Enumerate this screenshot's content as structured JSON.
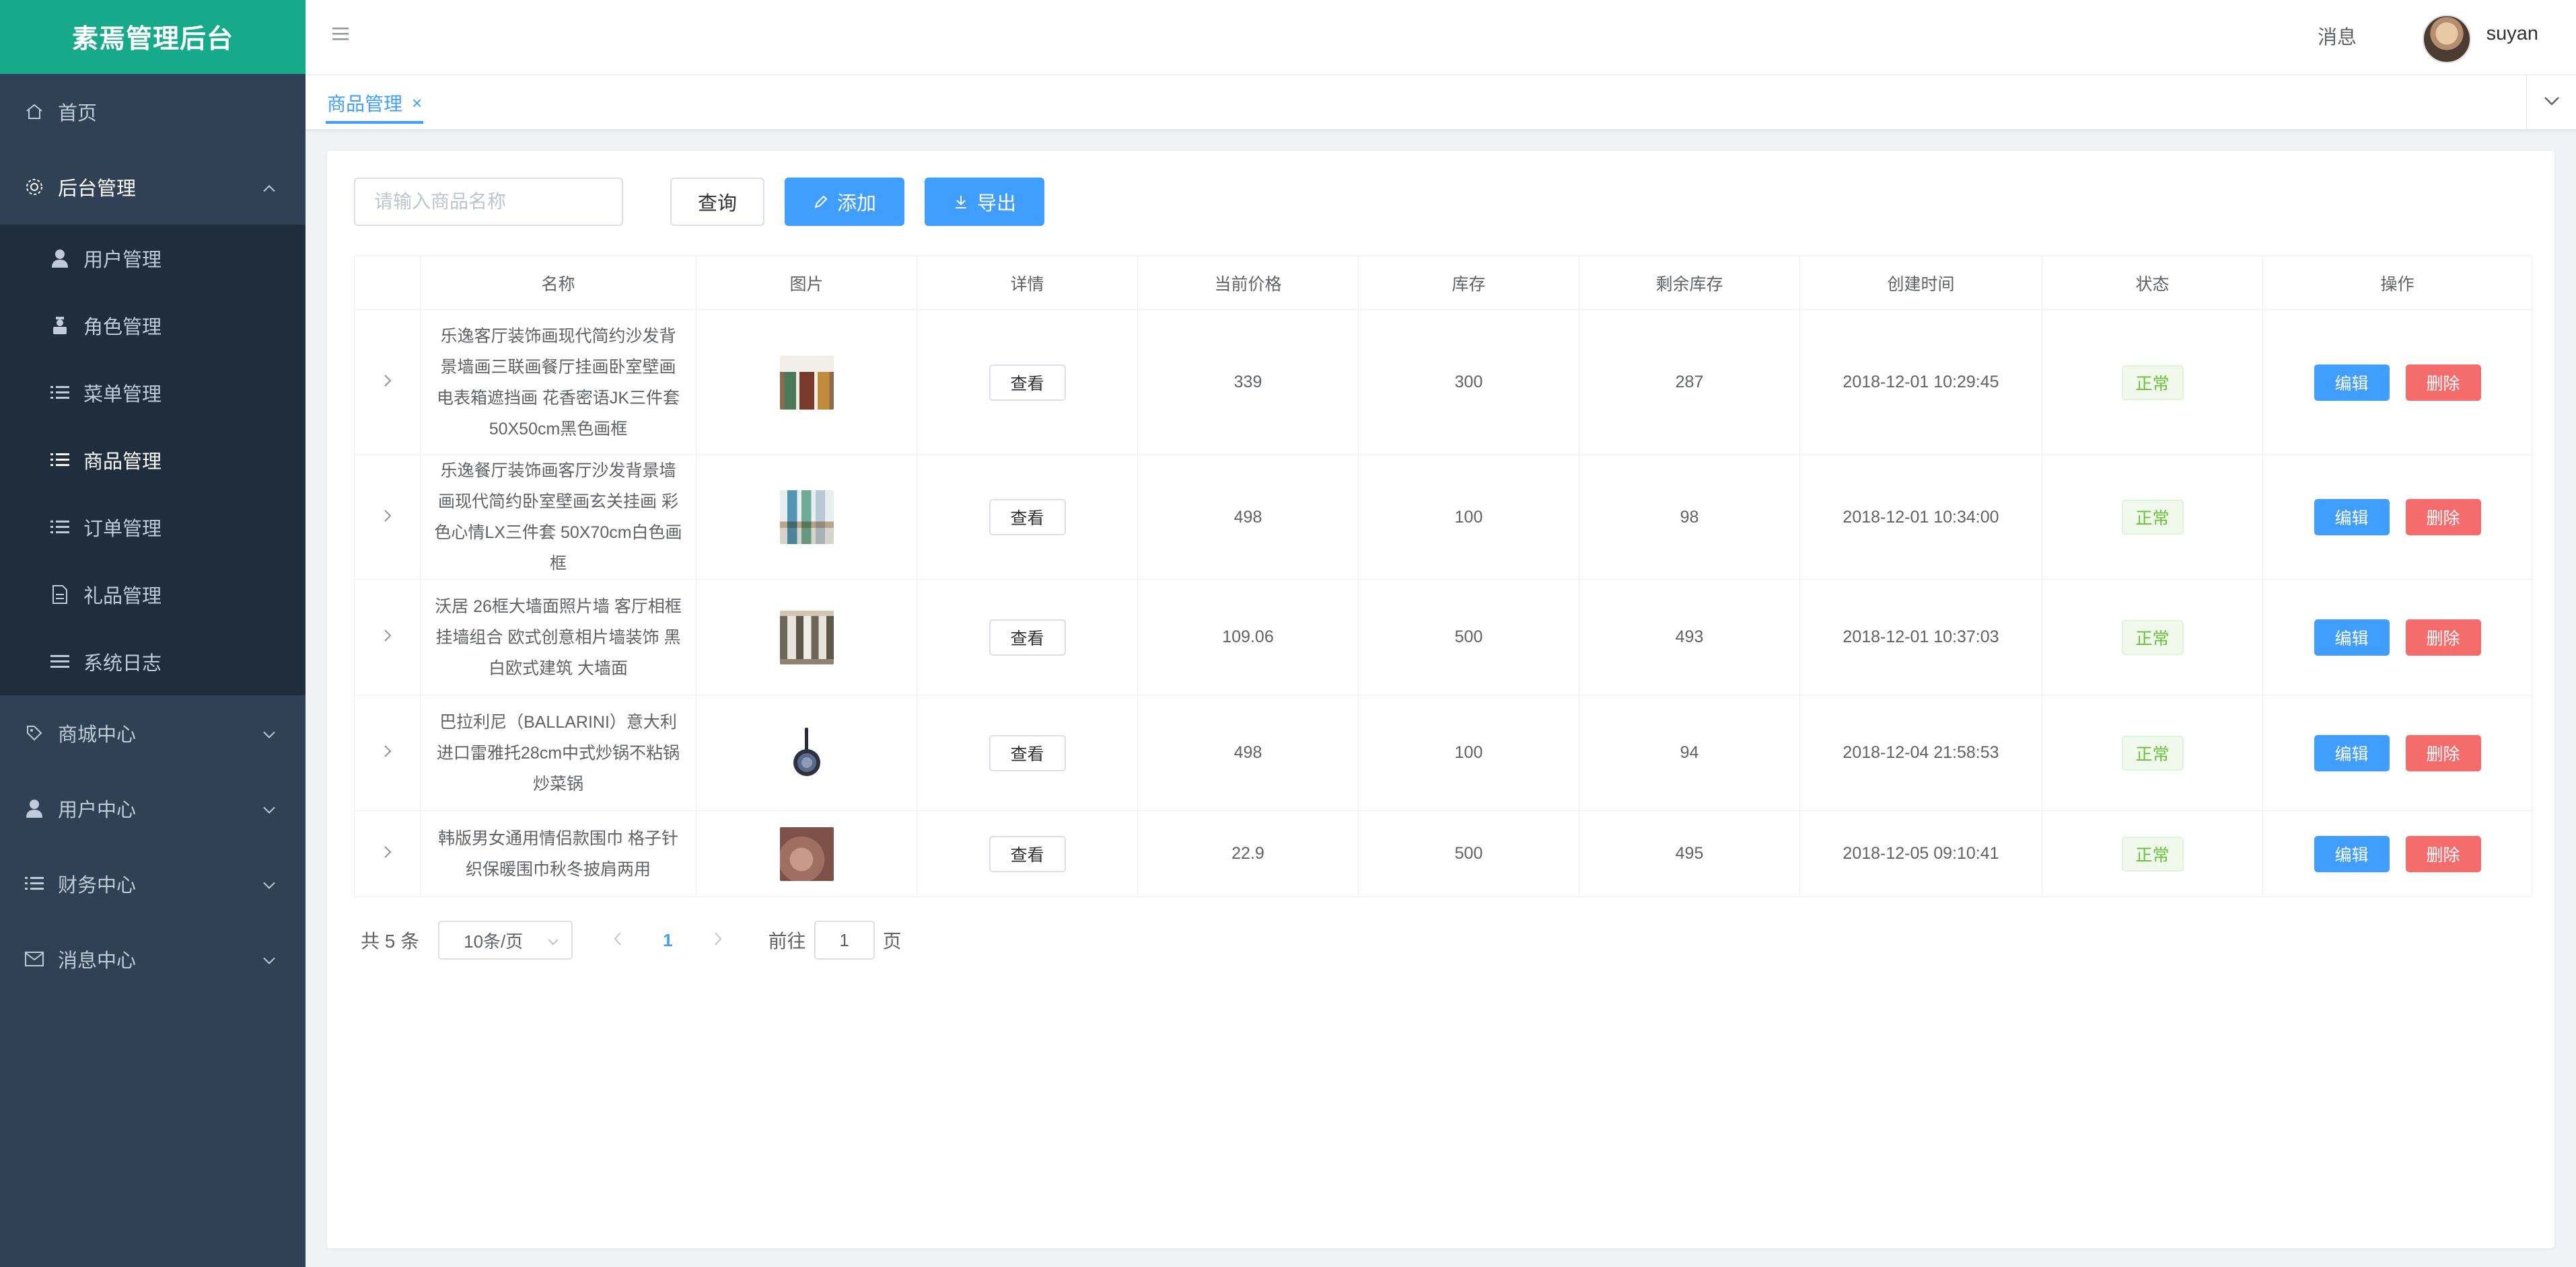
{
  "sidebar": {
    "logo": "素焉管理后台",
    "items": [
      {
        "label": "首页",
        "icon": "home-icon"
      },
      {
        "label": "后台管理",
        "icon": "gear-icon",
        "open": true
      },
      {
        "label": "商城中心",
        "icon": "tag-icon"
      },
      {
        "label": "用户中心",
        "icon": "user-icon"
      },
      {
        "label": "财务中心",
        "icon": "list-icon"
      },
      {
        "label": "消息中心",
        "icon": "mail-icon"
      }
    ],
    "sub_items": [
      {
        "label": "用户管理",
        "icon": "user-icon"
      },
      {
        "label": "角色管理",
        "icon": "role-icon"
      },
      {
        "label": "菜单管理",
        "icon": "list-icon"
      },
      {
        "label": "商品管理",
        "icon": "list-icon",
        "active": true
      },
      {
        "label": "订单管理",
        "icon": "list-icon"
      },
      {
        "label": "礼品管理",
        "icon": "document-icon"
      },
      {
        "label": "系统日志",
        "icon": "menu-icon"
      }
    ]
  },
  "header": {
    "messages": "消息",
    "username": "suyan"
  },
  "tags": [
    {
      "label": "商品管理",
      "close": "×"
    }
  ],
  "toolbar": {
    "search_placeholder": "请输入商品名称",
    "search_value": "",
    "query_label": "查询",
    "add_label": "添加",
    "export_label": "导出"
  },
  "table": {
    "columns": [
      "名称",
      "图片",
      "详情",
      "当前价格",
      "库存",
      "剩余库存",
      "创建时间",
      "状态",
      "操作"
    ],
    "rows": [
      {
        "name": "乐逸客厅装饰画现代简约沙发背景墙画三联画餐厅挂画卧室壁画电表箱遮挡画 花香密语JK三件套 50X50cm黑色画框",
        "view": "查看",
        "price": "339",
        "stock": "300",
        "remaining": "287",
        "created": "2018-12-01 10:29:45",
        "status": "正常",
        "edit": "编辑",
        "delete": "删除"
      },
      {
        "name": "乐逸餐厅装饰画客厅沙发背景墙画现代简约卧室壁画玄关挂画 彩色心情LX三件套 50X70cm白色画框",
        "view": "查看",
        "price": "498",
        "stock": "100",
        "remaining": "98",
        "created": "2018-12-01 10:34:00",
        "status": "正常",
        "edit": "编辑",
        "delete": "删除"
      },
      {
        "name": "沃居 26框大墙面照片墙 客厅相框挂墙组合 欧式创意相片墙装饰 黑白欧式建筑 大墙面",
        "view": "查看",
        "price": "109.06",
        "stock": "500",
        "remaining": "493",
        "created": "2018-12-01 10:37:03",
        "status": "正常",
        "edit": "编辑",
        "delete": "删除"
      },
      {
        "name": "巴拉利尼（BALLARINI）意大利进口雷雅托28cm中式炒锅不粘锅炒菜锅",
        "view": "查看",
        "price": "498",
        "stock": "100",
        "remaining": "94",
        "created": "2018-12-04 21:58:53",
        "status": "正常",
        "edit": "编辑",
        "delete": "删除"
      },
      {
        "name": "韩版男女通用情侣款围巾 格子针织保暖围巾秋冬披肩两用",
        "view": "查看",
        "price": "22.9",
        "stock": "500",
        "remaining": "495",
        "created": "2018-12-05 09:10:41",
        "status": "正常",
        "edit": "编辑",
        "delete": "删除"
      }
    ]
  },
  "pagination": {
    "total_label": "共 5 条",
    "page_size": "10条/页",
    "current_page": "1",
    "goto_prefix": "前往",
    "goto_value": "1",
    "goto_suffix": "页"
  },
  "colors": {
    "primary": "#409eff",
    "danger": "#f56c6c",
    "success": "#67c23a",
    "sidebar_bg": "#304156",
    "logo_bg": "#16a98a"
  }
}
